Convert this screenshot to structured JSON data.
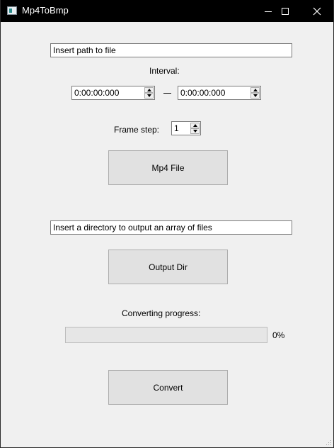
{
  "window": {
    "title": "Mp4ToBmp",
    "icon": "app-icon",
    "controls": [
      "minimize-icon",
      "maximize-icon",
      "close-icon"
    ]
  },
  "file_input": {
    "value": "Insert path to file"
  },
  "interval": {
    "label": "Interval:",
    "start": "0:00:00:000",
    "separator": "—",
    "end": "0:00:00:000"
  },
  "frame_step": {
    "label": "Frame step:",
    "value": "1"
  },
  "mp4_button": {
    "label": "Mp4 File"
  },
  "output_input": {
    "value": "Insert a directory to output an array of files"
  },
  "output_button": {
    "label": "Output Dir"
  },
  "progress": {
    "label": "Converting progress:",
    "value": 0,
    "text": "0%",
    "color": "#06b025"
  },
  "convert_button": {
    "label": "Convert"
  }
}
